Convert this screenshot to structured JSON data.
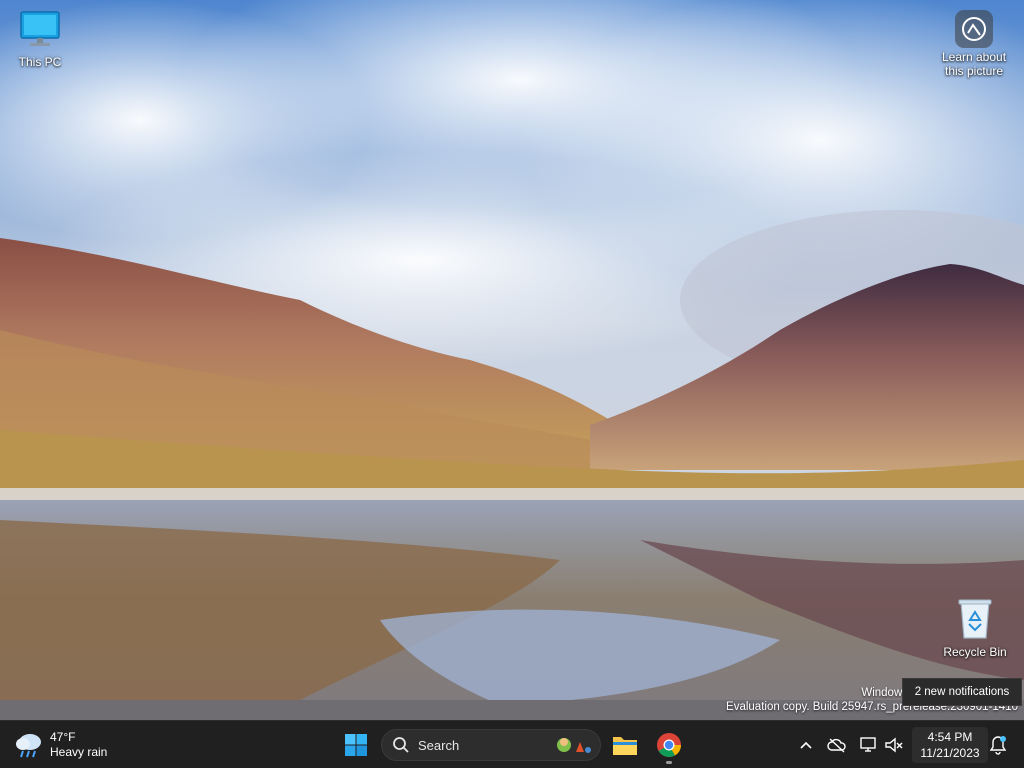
{
  "desktop": {
    "icons": {
      "this_pc": "This PC",
      "learn_line1": "Learn about",
      "learn_line2": "this picture",
      "recycle_bin": "Recycle Bin"
    },
    "watermark": {
      "line1": "Windows",
      "line2": "Evaluation copy. Build 25947.rs_prerelease.230901-1410"
    },
    "notification_tooltip": "2 new notifications"
  },
  "taskbar": {
    "weather": {
      "temperature": "47°F",
      "condition": "Heavy rain",
      "icon": "weather-rain-icon"
    },
    "search_placeholder": "Search",
    "pinned": [
      "start-button",
      "search-box",
      "file-explorer",
      "google-chrome"
    ],
    "tray": {
      "icons": [
        "chevron-up-icon",
        "cloud-offline-icon",
        "network-icon",
        "volume-muted-icon"
      ],
      "time": "4:54 PM",
      "date": "11/21/2023"
    }
  },
  "colors": {
    "taskbar_bg": "#202020",
    "accent_blue": "#0078d4"
  }
}
